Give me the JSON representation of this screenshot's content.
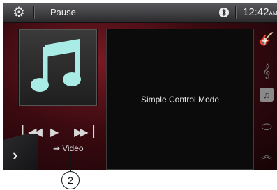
{
  "topbar": {
    "title": "Pause",
    "time": "12:42",
    "ampm": "AM"
  },
  "player": {
    "video_label": "Video"
  },
  "panel": {
    "text": "Simple Control Mode"
  },
  "callout": {
    "number": "2"
  },
  "icons": [
    "gear-icon",
    "bluetooth-icon",
    "music-note-icon",
    "previous-track-icon",
    "play-icon",
    "next-track-icon",
    "chevron-right-icon",
    "arrow-right-icon",
    "guitar-icon",
    "treble-clef-icon",
    "music-folder-icon",
    "cylinder-icon",
    "chevron-double-up-icon"
  ]
}
